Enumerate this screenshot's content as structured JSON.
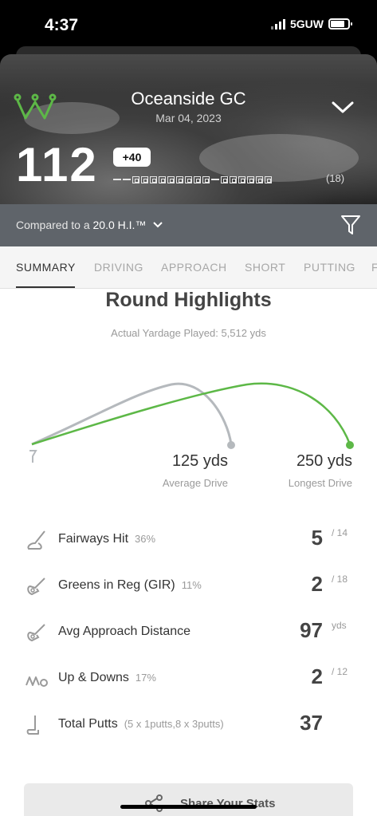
{
  "status": {
    "time": "4:37",
    "network": "5GUW"
  },
  "round": {
    "course": "Oceanside GC",
    "date": "Mar 04, 2023",
    "score": "112",
    "to_par": "+40",
    "holes_played": "(18)"
  },
  "compare": {
    "prefix": "Compared to a",
    "value": "20.0 H.I.™"
  },
  "tabs": [
    "SUMMARY",
    "DRIVING",
    "APPROACH",
    "SHORT",
    "PUTTING",
    "F"
  ],
  "highlights": {
    "title": "Round Highlights",
    "subtitle": "Actual Yardage Played: 5,512 yds",
    "avg_drive": {
      "value": "125 yds",
      "label": "Average Drive",
      "yards": 125
    },
    "long_drive": {
      "value": "250 yds",
      "label": "Longest Drive",
      "yards": 250
    }
  },
  "stats": [
    {
      "label": "Fairways Hit",
      "pct": "36%",
      "value": "5",
      "denom": "/ 14",
      "icon": "driver-icon"
    },
    {
      "label": "Greens in Reg (GIR)",
      "pct": "11%",
      "value": "2",
      "denom": "/ 18",
      "icon": "iron-icon"
    },
    {
      "label": "Avg Approach Distance",
      "pct": "",
      "value": "97",
      "denom": "yds",
      "icon": "iron-icon"
    },
    {
      "label": "Up & Downs",
      "pct": "17%",
      "value": "2",
      "denom": "/ 12",
      "icon": "chip-icon"
    },
    {
      "label": "Total Putts",
      "pct": "(5 x 1putts,8 x 3putts)",
      "value": "37",
      "denom": "",
      "icon": "putter-icon"
    }
  ],
  "share": {
    "label": "Share Your Stats"
  },
  "colors": {
    "accent_green": "#5db847",
    "avg_gray": "#b5b9bd"
  }
}
